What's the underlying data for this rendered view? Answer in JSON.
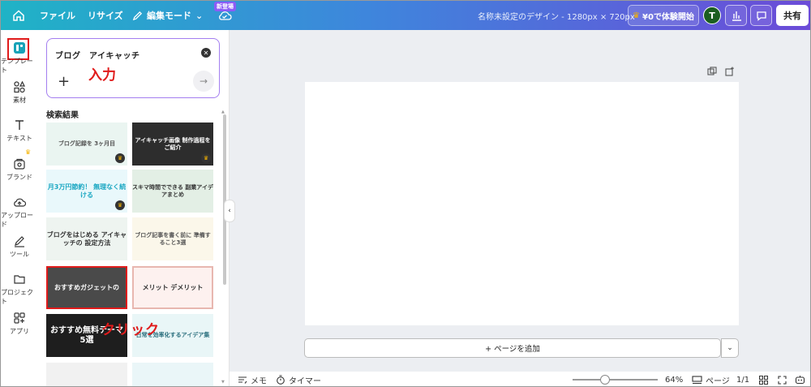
{
  "topbar": {
    "menu": {
      "file": "ファイル",
      "resize": "リサイズ",
      "edit_mode": "編集モード"
    },
    "new_badge": "新登場",
    "doc_title": "名称未設定のデザイン - 1280px × 720px",
    "trial_label": "¥0で体験開始",
    "avatar_initial": "T",
    "share_label": "共有"
  },
  "rail": {
    "items": [
      {
        "label": "テンプレート",
        "icon": "template-icon"
      },
      {
        "label": "素材",
        "icon": "elements-icon"
      },
      {
        "label": "テキスト",
        "icon": "text-icon"
      },
      {
        "label": "ブランド",
        "icon": "brand-icon"
      },
      {
        "label": "アップロード",
        "icon": "upload-icon"
      },
      {
        "label": "ツール",
        "icon": "pen-tool-icon"
      },
      {
        "label": "プロジェクト",
        "icon": "folder-icon"
      },
      {
        "label": "アプリ",
        "icon": "apps-icon"
      }
    ]
  },
  "panel": {
    "search_query": "ブログ　アイキャッチ",
    "annotation_input": "入力",
    "results_heading": "検索結果",
    "annotation_click": "クリック",
    "thumbnails": [
      {
        "text": "ブログ記録を 3ヶ月目",
        "bg": "#eaf5f1",
        "fg": "#555",
        "premium": true
      },
      {
        "text": "アイキャッチ画像 制作過程をご紹介",
        "bg": "#2d2d2d",
        "fg": "#ffffff",
        "premium": true
      },
      {
        "text": "月3万円節約！ 無理なく続ける",
        "bg": "#e9f8fb",
        "fg": "#1aa7c2",
        "premium": true
      },
      {
        "text": "スキマ時間でできる 副業アイデアまとめ",
        "bg": "#e3efe5",
        "fg": "#333",
        "premium": false
      },
      {
        "text": "ブログをはじめる アイキャッチの 設定方法",
        "bg": "#eef4f0",
        "fg": "#333",
        "premium": false
      },
      {
        "text": "ブログ記事を書く前に 準備すること3選",
        "bg": "#fbf7ea",
        "fg": "#555",
        "premium": false
      },
      {
        "text": "おすすめガジェットの",
        "bg": "#4a4a4a",
        "fg": "#ffffff",
        "premium": false
      },
      {
        "text": "メリット デメリット",
        "bg": "#fdf1ef",
        "fg": "#333",
        "premium": false
      },
      {
        "text": "おすすめ無料テーマ 5選",
        "bg": "#1e1e1e",
        "fg": "#ffffff",
        "premium": false
      },
      {
        "text": "日常を効率化するアイデア集",
        "bg": "#e9f6f7",
        "fg": "#2a6f7d",
        "premium": false
      },
      {
        "text": "",
        "bg": "#f1f1f1",
        "fg": "#333",
        "premium": false
      },
      {
        "text": "",
        "bg": "#eaf6f8",
        "fg": "#333",
        "premium": false
      }
    ]
  },
  "canvas": {
    "add_page_label": "+ ページを追加"
  },
  "footer": {
    "memo": "メモ",
    "timer": "タイマー",
    "zoom": "64%",
    "zoom_fraction": 0.38,
    "page_label": "ページ",
    "page_count": "1/1"
  },
  "colors": {
    "accent": "#7d2ae8",
    "annotation": "#e01b1b",
    "premium_crown": "#f5b301"
  }
}
